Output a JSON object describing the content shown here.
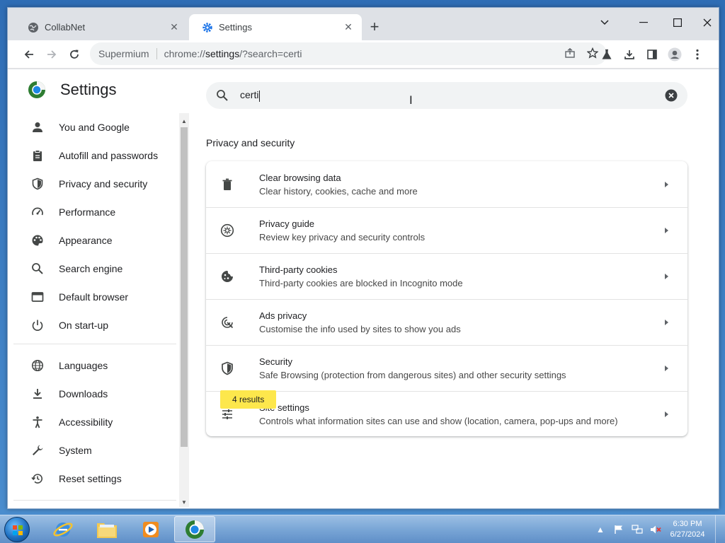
{
  "tabs": [
    {
      "title": "CollabNet",
      "icon": "globe-icon"
    },
    {
      "title": "Settings",
      "icon": "gear-icon"
    }
  ],
  "toolbar": {
    "site": "Supermium",
    "url_prefix": "chrome://",
    "url_host": "settings",
    "url_rest": "/?search=certi"
  },
  "settings": {
    "title": "Settings",
    "search_value": "certi",
    "nav": [
      {
        "label": "You and Google",
        "icon": "person-icon"
      },
      {
        "label": "Autofill and passwords",
        "icon": "clipboard-icon"
      },
      {
        "label": "Privacy and security",
        "icon": "shield-icon"
      },
      {
        "label": "Performance",
        "icon": "speedometer-icon"
      },
      {
        "label": "Appearance",
        "icon": "palette-icon"
      },
      {
        "label": "Search engine",
        "icon": "search-icon"
      },
      {
        "label": "Default browser",
        "icon": "browser-icon"
      },
      {
        "label": "On start-up",
        "icon": "power-icon"
      },
      {
        "label": "Languages",
        "icon": "globe-icon"
      },
      {
        "label": "Downloads",
        "icon": "download-icon"
      },
      {
        "label": "Accessibility",
        "icon": "accessibility-icon"
      },
      {
        "label": "System",
        "icon": "wrench-icon"
      },
      {
        "label": "Reset settings",
        "icon": "history-icon"
      }
    ],
    "section_title": "Privacy and security",
    "rows": [
      {
        "title": "Clear browsing data",
        "subtitle": "Clear history, cookies, cache and more",
        "icon": "trash-icon"
      },
      {
        "title": "Privacy guide",
        "subtitle": "Review key privacy and security controls",
        "icon": "privacy-guide-icon"
      },
      {
        "title": "Third-party cookies",
        "subtitle": "Third-party cookies are blocked in Incognito mode",
        "icon": "cookie-icon"
      },
      {
        "title": "Ads privacy",
        "subtitle": "Customise the info used by sites to show you ads",
        "icon": "ads-icon"
      },
      {
        "title": "Security",
        "subtitle": "Safe Browsing (protection from dangerous sites) and other security settings",
        "icon": "shield-icon"
      },
      {
        "title": "Site settings",
        "subtitle": "Controls what information sites can use and show (location, camera, pop-ups and more)",
        "icon": "sliders-icon"
      }
    ],
    "results_bubble": "4 results"
  },
  "taskbar": {
    "apps": [
      "internet-explorer-icon",
      "file-explorer-icon",
      "media-player-icon",
      "supermium-icon"
    ],
    "time": "6:30 PM",
    "date": "6/27/2024"
  }
}
